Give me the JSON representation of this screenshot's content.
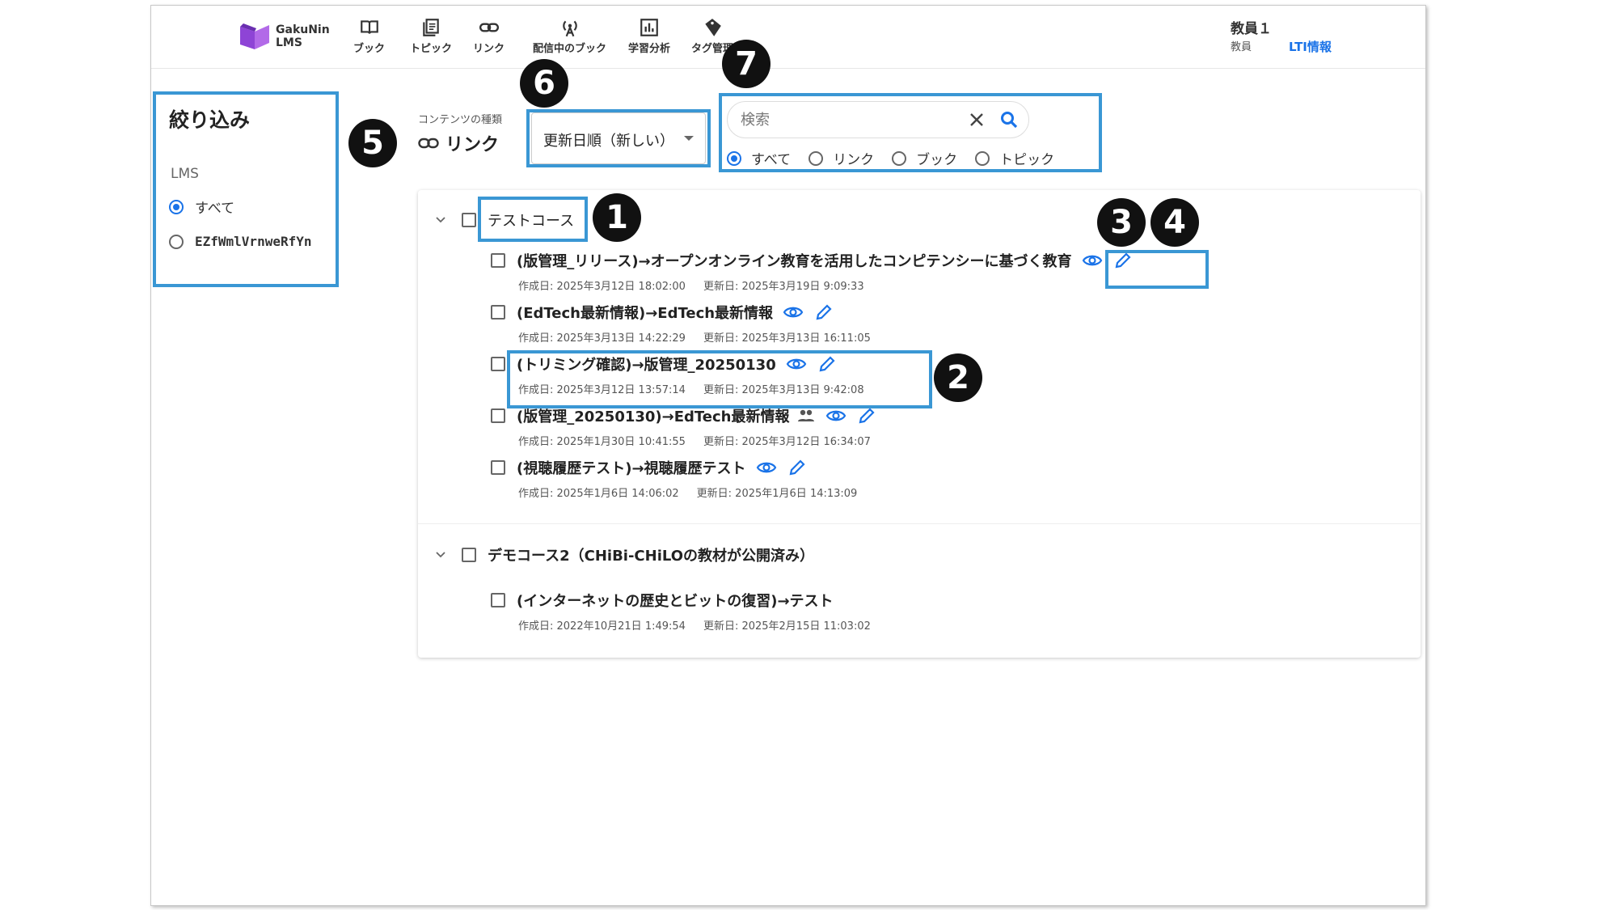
{
  "app": {
    "logo_line1": "GakuNin",
    "logo_line2": "LMS",
    "nav": [
      {
        "label": "ブック",
        "icon": "book-icon"
      },
      {
        "label": "トピック",
        "icon": "topic-icon"
      },
      {
        "label": "リンク",
        "icon": "link-icon"
      },
      {
        "label": "配信中のブック",
        "icon": "broadcast-icon"
      },
      {
        "label": "学習分析",
        "icon": "analytics-icon"
      },
      {
        "label": "タグ管理",
        "icon": "tag-icon"
      }
    ],
    "user_name": "教員１",
    "user_role": "教員",
    "lti_link": "LTI情報"
  },
  "filter": {
    "title": "絞り込み",
    "lms_label": "LMS",
    "options": [
      {
        "label": "すべて",
        "selected": true
      },
      {
        "label": "EZfWmlVrnweRfYn",
        "selected": false
      }
    ]
  },
  "content_type": {
    "label": "コンテンツの種類",
    "value": "リンク"
  },
  "sort": {
    "value": "更新日順（新しい）"
  },
  "search": {
    "placeholder": "検索",
    "value": "",
    "types": [
      {
        "label": "すべて",
        "selected": true
      },
      {
        "label": "リンク",
        "selected": false
      },
      {
        "label": "ブック",
        "selected": false
      },
      {
        "label": "トピック",
        "selected": false
      }
    ]
  },
  "courses": [
    {
      "title": "テストコース",
      "items": [
        {
          "title": "(版管理_リリース)→オープンオンライン教育を活用したコンピテンシーに基づく教育",
          "created": "作成日: 2025年3月12日 18:02:00",
          "updated": "更新日: 2025年3月19日 9:09:33",
          "shared": false
        },
        {
          "title": "(EdTech最新情報)→EdTech最新情報",
          "created": "作成日: 2025年3月13日 14:22:29",
          "updated": "更新日: 2025年3月13日 16:11:05",
          "shared": false
        },
        {
          "title": "(トリミング確認)→版管理_20250130",
          "created": "作成日: 2025年3月12日 13:57:14",
          "updated": "更新日: 2025年3月13日 9:42:08",
          "shared": false
        },
        {
          "title": "(版管理_20250130)→EdTech最新情報",
          "created": "作成日: 2025年1月30日 10:41:55",
          "updated": "更新日: 2025年3月12日 16:34:07",
          "shared": true
        },
        {
          "title": "(視聴履歴テスト)→視聴履歴テスト",
          "created": "作成日: 2025年1月6日 14:06:02",
          "updated": "更新日: 2025年1月6日 14:13:09",
          "shared": false
        }
      ]
    },
    {
      "title": "デモコース2（CHiBi-CHiLOの教材が公開済み）",
      "items": [
        {
          "title": "(インターネットの歴史とビットの復習)→テスト",
          "created": "作成日: 2022年10月21日 1:49:54",
          "updated": "更新日: 2025年2月15日 11:03:02",
          "shared": false
        }
      ]
    }
  ],
  "annotations": [
    "1",
    "2",
    "3",
    "4",
    "5",
    "6",
    "7"
  ],
  "colors": {
    "accent": "#1a73e8",
    "highlight": "#3a97d4",
    "badge": "#111111",
    "logo": "#8e44d6"
  }
}
